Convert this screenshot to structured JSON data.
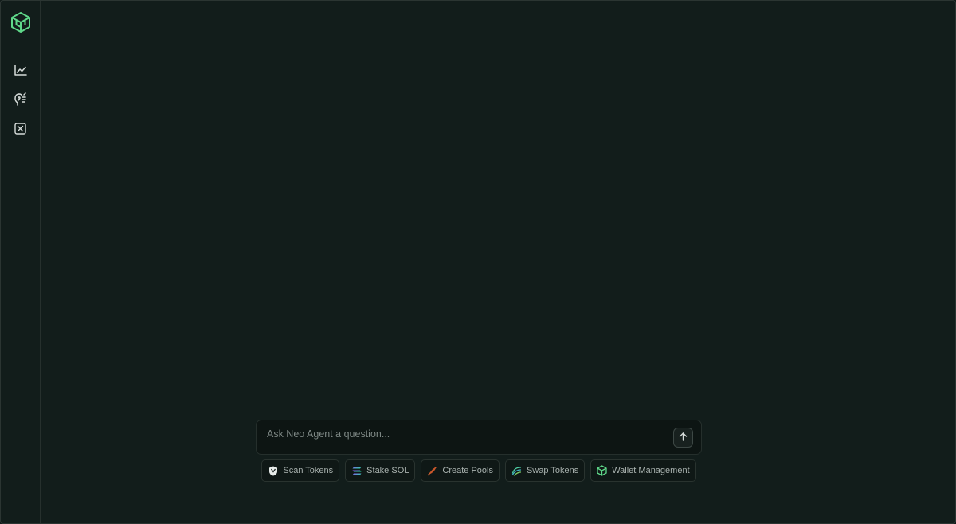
{
  "sidebar": {
    "logo": {
      "icon": "cube-logo-icon",
      "color": "#5fd98a"
    },
    "items": [
      {
        "icon": "line-chart-icon"
      },
      {
        "icon": "agent-brain-icon"
      },
      {
        "icon": "x-box-icon"
      }
    ]
  },
  "composer": {
    "placeholder": "Ask Neo Agent a question...",
    "value": "",
    "send_icon": "arrow-up-icon"
  },
  "quick_actions": [
    {
      "label": "Scan Tokens",
      "icon": "shield-token-icon"
    },
    {
      "label": "Stake SOL",
      "icon": "solana-icon"
    },
    {
      "label": "Create Pools",
      "icon": "feather-icon"
    },
    {
      "label": "Swap Tokens",
      "icon": "swirl-icon"
    },
    {
      "label": "Wallet Management",
      "icon": "cube-wallet-icon"
    }
  ],
  "colors": {
    "background": "#121d1b",
    "accent": "#5fd98a",
    "text_muted": "#7d8784"
  }
}
